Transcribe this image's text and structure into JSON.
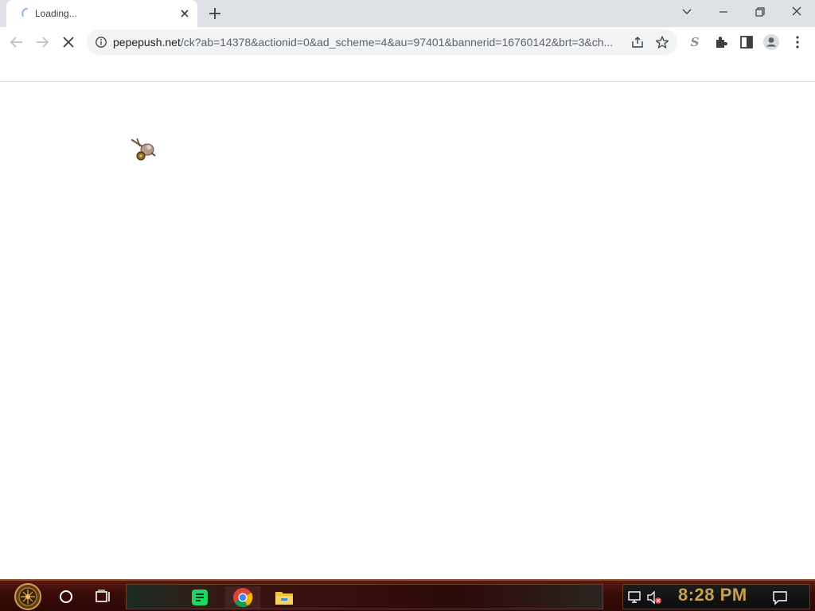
{
  "browser": {
    "tab": {
      "title": "Loading...",
      "icon": "loading-spinner-icon"
    },
    "address_bar": {
      "host": "pepepush.net",
      "path": "/ck?ab=14378&actionid=0&ad_scheme=4&au=97401&bannerid=16760142&brt=3&ch..."
    },
    "toolbar_icons": [
      "back-arrow-icon",
      "forward-arrow-icon",
      "stop-loading-icon",
      "site-info-icon",
      "share-icon",
      "bookmark-star-icon",
      "extension-s-icon",
      "extensions-puzzle-icon",
      "side-panel-icon",
      "profile-icon",
      "menu-icon"
    ],
    "window_controls": [
      "tab-search-icon",
      "minimize-icon",
      "restore-icon",
      "close-icon"
    ]
  },
  "taskbar": {
    "clock": "8:28 PM",
    "pinned": [
      "search-circle-icon",
      "task-view-icon",
      "notes-app-icon",
      "chrome-icon",
      "file-explorer-icon"
    ],
    "tray": [
      "network-icon",
      "volume-muted-icon",
      "notification-icon"
    ],
    "accent": "#c8a050"
  }
}
